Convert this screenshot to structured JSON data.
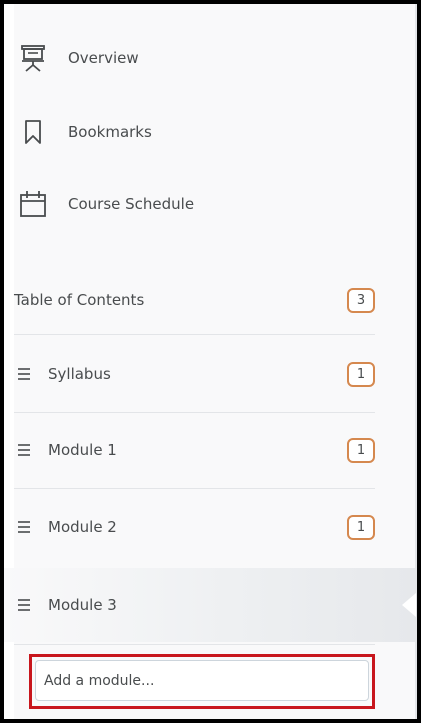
{
  "nav": {
    "overview": {
      "label": "Overview",
      "icon": "presentation-icon"
    },
    "bookmarks": {
      "label": "Bookmarks",
      "icon": "bookmark-icon"
    },
    "schedule": {
      "label": "Course Schedule",
      "icon": "calendar-icon"
    }
  },
  "toc": {
    "title": "Table of Contents",
    "count": "3"
  },
  "modules": [
    {
      "label": "Syllabus",
      "count": "1"
    },
    {
      "label": "Module 1",
      "count": "1"
    },
    {
      "label": "Module 2",
      "count": "1"
    },
    {
      "label": "Module 3",
      "count": "",
      "selected": true
    }
  ],
  "add_module": {
    "placeholder": "Add a module..."
  },
  "colors": {
    "badge_border": "#d5884e",
    "highlight_border": "#c8161d",
    "text": "#494c4e"
  }
}
